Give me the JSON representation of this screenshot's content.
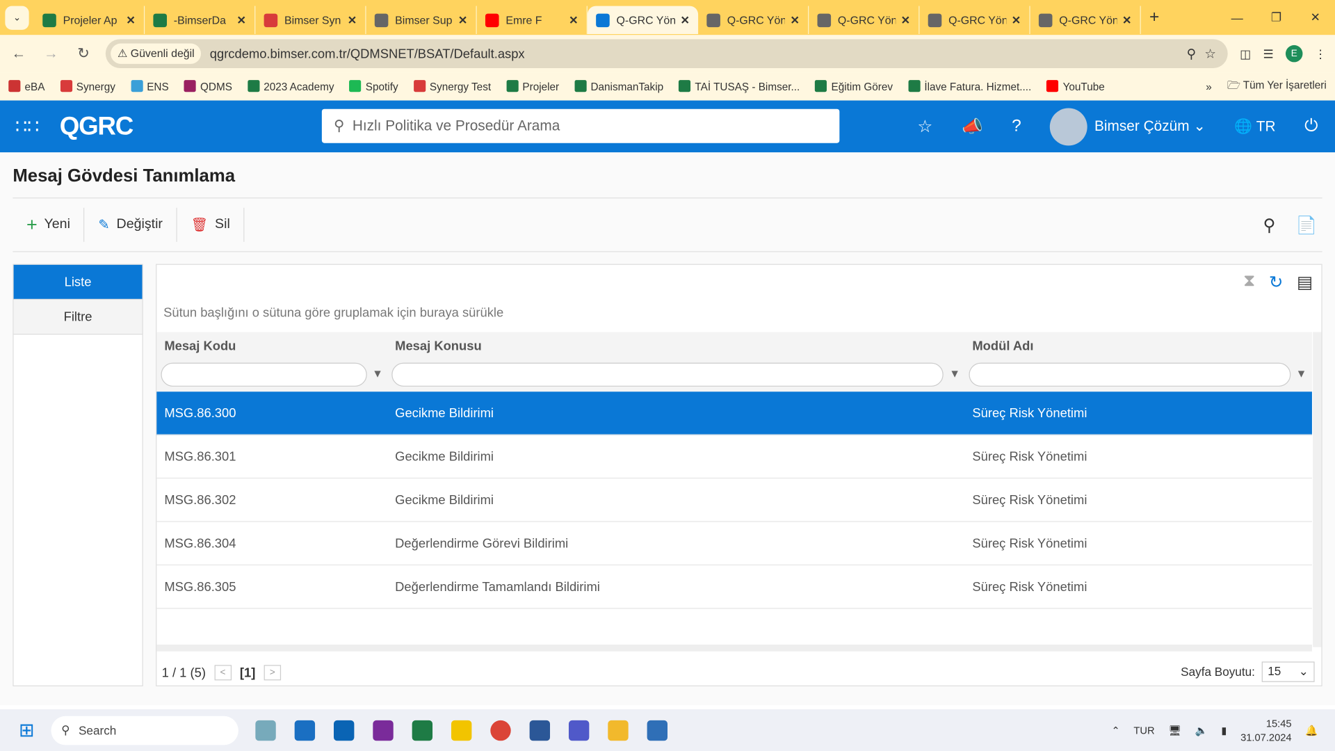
{
  "browser": {
    "tabs": [
      {
        "title": "Projeler Ap",
        "color": "#1e7b45"
      },
      {
        "title": "-BimserDa",
        "color": "#1e7b45"
      },
      {
        "title": "Bimser Syn",
        "color": "#d83b3b"
      },
      {
        "title": "Bimser Sup",
        "color": "#666666"
      },
      {
        "title": "Emre F",
        "color": "#ff0000"
      },
      {
        "title": "Q-GRC Yön",
        "color": "#0a78d6",
        "active": true
      },
      {
        "title": "Q-GRC Yön",
        "color": "#666666"
      },
      {
        "title": "Q-GRC Yön",
        "color": "#666666"
      },
      {
        "title": "Q-GRC Yön",
        "color": "#666666"
      },
      {
        "title": "Q-GRC Yön",
        "color": "#666666"
      }
    ],
    "security": "Güvenli değil",
    "url": "qgrcdemo.bimser.com.tr/QDMSNET/BSAT/Default.aspx",
    "profile": "E",
    "bookmarks": [
      "eBA",
      "Synergy",
      "ENS",
      "QDMS",
      "2023 Academy",
      "Spotify",
      "Synergy Test",
      "Projeler",
      "DanismanTakip",
      "TAİ TUSAŞ - Bimser...",
      "Eğitim Görev",
      "İlave Fatura. Hizmet....",
      "YouTube"
    ],
    "all_bookmarks": "Tüm Yer İşaretleri"
  },
  "header": {
    "logo": "QGRC",
    "search_placeholder": "Hızlı Politika ve Prosedür Arama",
    "user": "Bimser Çözüm",
    "lang": "TR"
  },
  "page": {
    "title": "Mesaj Gövdesi Tanımlama",
    "toolbar": {
      "new": "Yeni",
      "edit": "Değiştir",
      "delete": "Sil"
    },
    "side": {
      "list": "Liste",
      "filter": "Filtre"
    },
    "group_hint": "Sütun başlığını o sütuna göre gruplamak için buraya sürükle",
    "columns": [
      "Mesaj Kodu",
      "Mesaj Konusu",
      "Modül Adı"
    ],
    "rows": [
      [
        "MSG.86.300",
        "Gecikme Bildirimi",
        "Süreç Risk Yönetimi"
      ],
      [
        "MSG.86.301",
        "Gecikme Bildirimi",
        "Süreç Risk Yönetimi"
      ],
      [
        "MSG.86.302",
        "Gecikme Bildirimi",
        "Süreç Risk Yönetimi"
      ],
      [
        "MSG.86.304",
        "Değerlendirme Görevi Bildirimi",
        "Süreç Risk Yönetimi"
      ],
      [
        "MSG.86.305",
        "Değerlendirme Tamamlandı Bildirimi",
        "Süreç Risk Yönetimi"
      ]
    ],
    "selected_row": 0,
    "pager": {
      "summary": "1 / 1 (5)",
      "current": "[1]",
      "size_label": "Sayfa Boyutu:",
      "size": "15"
    }
  },
  "taskbar": {
    "search": "Search",
    "lang": "TUR",
    "time": "15:45",
    "date": "31.07.2024"
  }
}
